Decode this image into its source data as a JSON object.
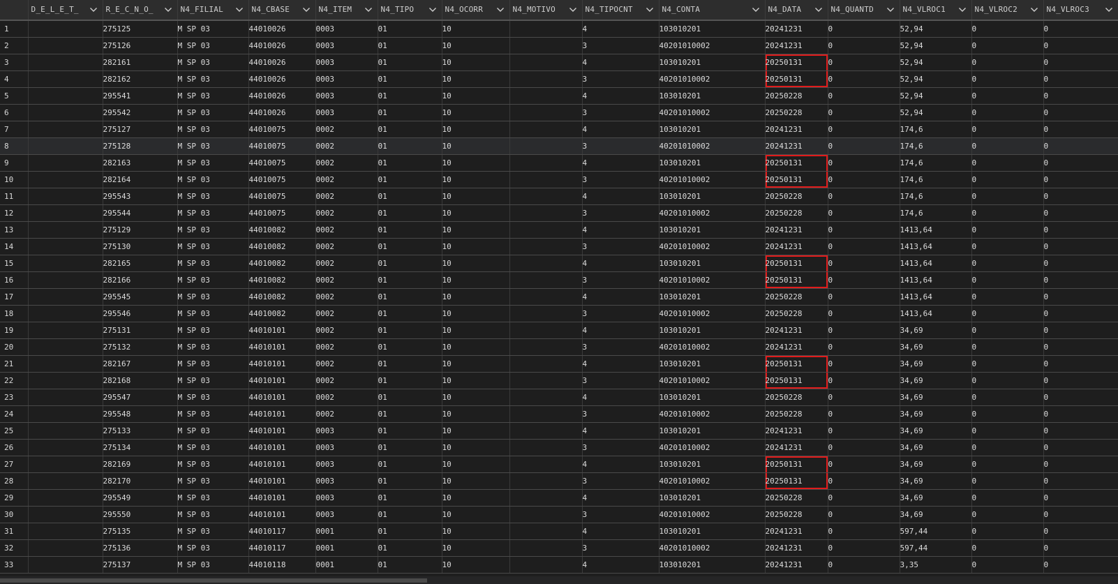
{
  "columns": [
    {
      "label": "",
      "filter": false
    },
    {
      "label": "D_E_L_E_T_",
      "filter": true
    },
    {
      "label": "R_E_C_N_O_",
      "filter": true
    },
    {
      "label": "N4_FILIAL",
      "filter": true
    },
    {
      "label": "N4_CBASE",
      "filter": true
    },
    {
      "label": "N4_ITEM",
      "filter": true
    },
    {
      "label": "N4_TIPO",
      "filter": true
    },
    {
      "label": "N4_OCORR",
      "filter": true
    },
    {
      "label": "N4_MOTIVO",
      "filter": true
    },
    {
      "label": "N4_TIPOCNT",
      "filter": true
    },
    {
      "label": "N4_CONTA",
      "filter": true
    },
    {
      "label": "N4_DATA",
      "filter": true
    },
    {
      "label": "N4_QUANTD",
      "filter": true
    },
    {
      "label": "N4_VLROC1",
      "filter": true
    },
    {
      "label": "N4_VLROC2",
      "filter": true
    },
    {
      "label": "N4_VLROC3",
      "filter": true
    }
  ],
  "highlight_color": "#e01b1b",
  "rows": [
    {
      "n": "1",
      "deleted": "",
      "recno": "275125",
      "filial": "M SP 03",
      "cbase": "44010026",
      "item": "0003",
      "tipo": "01",
      "ocorr": "10",
      "motivo": "",
      "tipocnt": "4",
      "conta": "103010201",
      "data": "20241231",
      "quantd": "0",
      "vlroc1": "52,94",
      "vlroc2": "0",
      "vlroc3": "0",
      "hl": ""
    },
    {
      "n": "2",
      "deleted": "",
      "recno": "275126",
      "filial": "M SP 03",
      "cbase": "44010026",
      "item": "0003",
      "tipo": "01",
      "ocorr": "10",
      "motivo": "",
      "tipocnt": "3",
      "conta": "40201010002",
      "data": "20241231",
      "quantd": "0",
      "vlroc1": "52,94",
      "vlroc2": "0",
      "vlroc3": "0",
      "hl": ""
    },
    {
      "n": "3",
      "deleted": "",
      "recno": "282161",
      "filial": "M SP 03",
      "cbase": "44010026",
      "item": "0003",
      "tipo": "01",
      "ocorr": "10",
      "motivo": "",
      "tipocnt": "4",
      "conta": "103010201",
      "data": "20250131",
      "quantd": "0",
      "vlroc1": "52,94",
      "vlroc2": "0",
      "vlroc3": "0",
      "hl": "top"
    },
    {
      "n": "4",
      "deleted": "",
      "recno": "282162",
      "filial": "M SP 03",
      "cbase": "44010026",
      "item": "0003",
      "tipo": "01",
      "ocorr": "10",
      "motivo": "",
      "tipocnt": "3",
      "conta": "40201010002",
      "data": "20250131",
      "quantd": "0",
      "vlroc1": "52,94",
      "vlroc2": "0",
      "vlroc3": "0",
      "hl": "bot"
    },
    {
      "n": "5",
      "deleted": "",
      "recno": "295541",
      "filial": "M SP 03",
      "cbase": "44010026",
      "item": "0003",
      "tipo": "01",
      "ocorr": "10",
      "motivo": "",
      "tipocnt": "4",
      "conta": "103010201",
      "data": "20250228",
      "quantd": "0",
      "vlroc1": "52,94",
      "vlroc2": "0",
      "vlroc3": "0",
      "hl": ""
    },
    {
      "n": "6",
      "deleted": "",
      "recno": "295542",
      "filial": "M SP 03",
      "cbase": "44010026",
      "item": "0003",
      "tipo": "01",
      "ocorr": "10",
      "motivo": "",
      "tipocnt": "3",
      "conta": "40201010002",
      "data": "20250228",
      "quantd": "0",
      "vlroc1": "52,94",
      "vlroc2": "0",
      "vlroc3": "0",
      "hl": ""
    },
    {
      "n": "7",
      "deleted": "",
      "recno": "275127",
      "filial": "M SP 03",
      "cbase": "44010075",
      "item": "0002",
      "tipo": "01",
      "ocorr": "10",
      "motivo": "",
      "tipocnt": "4",
      "conta": "103010201",
      "data": "20241231",
      "quantd": "0",
      "vlroc1": "174,6",
      "vlroc2": "0",
      "vlroc3": "0",
      "hl": ""
    },
    {
      "n": "8",
      "deleted": "",
      "recno": "275128",
      "filial": "M SP 03",
      "cbase": "44010075",
      "item": "0002",
      "tipo": "01",
      "ocorr": "10",
      "motivo": "",
      "tipocnt": "3",
      "conta": "40201010002",
      "data": "20241231",
      "quantd": "0",
      "vlroc1": "174,6",
      "vlroc2": "0",
      "vlroc3": "0",
      "hl": "",
      "alt": true
    },
    {
      "n": "9",
      "deleted": "",
      "recno": "282163",
      "filial": "M SP 03",
      "cbase": "44010075",
      "item": "0002",
      "tipo": "01",
      "ocorr": "10",
      "motivo": "",
      "tipocnt": "4",
      "conta": "103010201",
      "data": "20250131",
      "quantd": "0",
      "vlroc1": "174,6",
      "vlroc2": "0",
      "vlroc3": "0",
      "hl": "top"
    },
    {
      "n": "10",
      "deleted": "",
      "recno": "282164",
      "filial": "M SP 03",
      "cbase": "44010075",
      "item": "0002",
      "tipo": "01",
      "ocorr": "10",
      "motivo": "",
      "tipocnt": "3",
      "conta": "40201010002",
      "data": "20250131",
      "quantd": "0",
      "vlroc1": "174,6",
      "vlroc2": "0",
      "vlroc3": "0",
      "hl": "bot"
    },
    {
      "n": "11",
      "deleted": "",
      "recno": "295543",
      "filial": "M SP 03",
      "cbase": "44010075",
      "item": "0002",
      "tipo": "01",
      "ocorr": "10",
      "motivo": "",
      "tipocnt": "4",
      "conta": "103010201",
      "data": "20250228",
      "quantd": "0",
      "vlroc1": "174,6",
      "vlroc2": "0",
      "vlroc3": "0",
      "hl": ""
    },
    {
      "n": "12",
      "deleted": "",
      "recno": "295544",
      "filial": "M SP 03",
      "cbase": "44010075",
      "item": "0002",
      "tipo": "01",
      "ocorr": "10",
      "motivo": "",
      "tipocnt": "3",
      "conta": "40201010002",
      "data": "20250228",
      "quantd": "0",
      "vlroc1": "174,6",
      "vlroc2": "0",
      "vlroc3": "0",
      "hl": ""
    },
    {
      "n": "13",
      "deleted": "",
      "recno": "275129",
      "filial": "M SP 03",
      "cbase": "44010082",
      "item": "0002",
      "tipo": "01",
      "ocorr": "10",
      "motivo": "",
      "tipocnt": "4",
      "conta": "103010201",
      "data": "20241231",
      "quantd": "0",
      "vlroc1": "1413,64",
      "vlroc2": "0",
      "vlroc3": "0",
      "hl": ""
    },
    {
      "n": "14",
      "deleted": "",
      "recno": "275130",
      "filial": "M SP 03",
      "cbase": "44010082",
      "item": "0002",
      "tipo": "01",
      "ocorr": "10",
      "motivo": "",
      "tipocnt": "3",
      "conta": "40201010002",
      "data": "20241231",
      "quantd": "0",
      "vlroc1": "1413,64",
      "vlroc2": "0",
      "vlroc3": "0",
      "hl": ""
    },
    {
      "n": "15",
      "deleted": "",
      "recno": "282165",
      "filial": "M SP 03",
      "cbase": "44010082",
      "item": "0002",
      "tipo": "01",
      "ocorr": "10",
      "motivo": "",
      "tipocnt": "4",
      "conta": "103010201",
      "data": "20250131",
      "quantd": "0",
      "vlroc1": "1413,64",
      "vlroc2": "0",
      "vlroc3": "0",
      "hl": "top"
    },
    {
      "n": "16",
      "deleted": "",
      "recno": "282166",
      "filial": "M SP 03",
      "cbase": "44010082",
      "item": "0002",
      "tipo": "01",
      "ocorr": "10",
      "motivo": "",
      "tipocnt": "3",
      "conta": "40201010002",
      "data": "20250131",
      "quantd": "0",
      "vlroc1": "1413,64",
      "vlroc2": "0",
      "vlroc3": "0",
      "hl": "bot"
    },
    {
      "n": "17",
      "deleted": "",
      "recno": "295545",
      "filial": "M SP 03",
      "cbase": "44010082",
      "item": "0002",
      "tipo": "01",
      "ocorr": "10",
      "motivo": "",
      "tipocnt": "4",
      "conta": "103010201",
      "data": "20250228",
      "quantd": "0",
      "vlroc1": "1413,64",
      "vlroc2": "0",
      "vlroc3": "0",
      "hl": ""
    },
    {
      "n": "18",
      "deleted": "",
      "recno": "295546",
      "filial": "M SP 03",
      "cbase": "44010082",
      "item": "0002",
      "tipo": "01",
      "ocorr": "10",
      "motivo": "",
      "tipocnt": "3",
      "conta": "40201010002",
      "data": "20250228",
      "quantd": "0",
      "vlroc1": "1413,64",
      "vlroc2": "0",
      "vlroc3": "0",
      "hl": ""
    },
    {
      "n": "19",
      "deleted": "",
      "recno": "275131",
      "filial": "M SP 03",
      "cbase": "44010101",
      "item": "0002",
      "tipo": "01",
      "ocorr": "10",
      "motivo": "",
      "tipocnt": "4",
      "conta": "103010201",
      "data": "20241231",
      "quantd": "0",
      "vlroc1": "34,69",
      "vlroc2": "0",
      "vlroc3": "0",
      "hl": ""
    },
    {
      "n": "20",
      "deleted": "",
      "recno": "275132",
      "filial": "M SP 03",
      "cbase": "44010101",
      "item": "0002",
      "tipo": "01",
      "ocorr": "10",
      "motivo": "",
      "tipocnt": "3",
      "conta": "40201010002",
      "data": "20241231",
      "quantd": "0",
      "vlroc1": "34,69",
      "vlroc2": "0",
      "vlroc3": "0",
      "hl": ""
    },
    {
      "n": "21",
      "deleted": "",
      "recno": "282167",
      "filial": "M SP 03",
      "cbase": "44010101",
      "item": "0002",
      "tipo": "01",
      "ocorr": "10",
      "motivo": "",
      "tipocnt": "4",
      "conta": "103010201",
      "data": "20250131",
      "quantd": "0",
      "vlroc1": "34,69",
      "vlroc2": "0",
      "vlroc3": "0",
      "hl": "top"
    },
    {
      "n": "22",
      "deleted": "",
      "recno": "282168",
      "filial": "M SP 03",
      "cbase": "44010101",
      "item": "0002",
      "tipo": "01",
      "ocorr": "10",
      "motivo": "",
      "tipocnt": "3",
      "conta": "40201010002",
      "data": "20250131",
      "quantd": "0",
      "vlroc1": "34,69",
      "vlroc2": "0",
      "vlroc3": "0",
      "hl": "bot"
    },
    {
      "n": "23",
      "deleted": "",
      "recno": "295547",
      "filial": "M SP 03",
      "cbase": "44010101",
      "item": "0002",
      "tipo": "01",
      "ocorr": "10",
      "motivo": "",
      "tipocnt": "4",
      "conta": "103010201",
      "data": "20250228",
      "quantd": "0",
      "vlroc1": "34,69",
      "vlroc2": "0",
      "vlroc3": "0",
      "hl": ""
    },
    {
      "n": "24",
      "deleted": "",
      "recno": "295548",
      "filial": "M SP 03",
      "cbase": "44010101",
      "item": "0002",
      "tipo": "01",
      "ocorr": "10",
      "motivo": "",
      "tipocnt": "3",
      "conta": "40201010002",
      "data": "20250228",
      "quantd": "0",
      "vlroc1": "34,69",
      "vlroc2": "0",
      "vlroc3": "0",
      "hl": ""
    },
    {
      "n": "25",
      "deleted": "",
      "recno": "275133",
      "filial": "M SP 03",
      "cbase": "44010101",
      "item": "0003",
      "tipo": "01",
      "ocorr": "10",
      "motivo": "",
      "tipocnt": "4",
      "conta": "103010201",
      "data": "20241231",
      "quantd": "0",
      "vlroc1": "34,69",
      "vlroc2": "0",
      "vlroc3": "0",
      "hl": ""
    },
    {
      "n": "26",
      "deleted": "",
      "recno": "275134",
      "filial": "M SP 03",
      "cbase": "44010101",
      "item": "0003",
      "tipo": "01",
      "ocorr": "10",
      "motivo": "",
      "tipocnt": "3",
      "conta": "40201010002",
      "data": "20241231",
      "quantd": "0",
      "vlroc1": "34,69",
      "vlroc2": "0",
      "vlroc3": "0",
      "hl": ""
    },
    {
      "n": "27",
      "deleted": "",
      "recno": "282169",
      "filial": "M SP 03",
      "cbase": "44010101",
      "item": "0003",
      "tipo": "01",
      "ocorr": "10",
      "motivo": "",
      "tipocnt": "4",
      "conta": "103010201",
      "data": "20250131",
      "quantd": "0",
      "vlroc1": "34,69",
      "vlroc2": "0",
      "vlroc3": "0",
      "hl": "top"
    },
    {
      "n": "28",
      "deleted": "",
      "recno": "282170",
      "filial": "M SP 03",
      "cbase": "44010101",
      "item": "0003",
      "tipo": "01",
      "ocorr": "10",
      "motivo": "",
      "tipocnt": "3",
      "conta": "40201010002",
      "data": "20250131",
      "quantd": "0",
      "vlroc1": "34,69",
      "vlroc2": "0",
      "vlroc3": "0",
      "hl": "bot"
    },
    {
      "n": "29",
      "deleted": "",
      "recno": "295549",
      "filial": "M SP 03",
      "cbase": "44010101",
      "item": "0003",
      "tipo": "01",
      "ocorr": "10",
      "motivo": "",
      "tipocnt": "4",
      "conta": "103010201",
      "data": "20250228",
      "quantd": "0",
      "vlroc1": "34,69",
      "vlroc2": "0",
      "vlroc3": "0",
      "hl": ""
    },
    {
      "n": "30",
      "deleted": "",
      "recno": "295550",
      "filial": "M SP 03",
      "cbase": "44010101",
      "item": "0003",
      "tipo": "01",
      "ocorr": "10",
      "motivo": "",
      "tipocnt": "3",
      "conta": "40201010002",
      "data": "20250228",
      "quantd": "0",
      "vlroc1": "34,69",
      "vlroc2": "0",
      "vlroc3": "0",
      "hl": ""
    },
    {
      "n": "31",
      "deleted": "",
      "recno": "275135",
      "filial": "M SP 03",
      "cbase": "44010117",
      "item": "0001",
      "tipo": "01",
      "ocorr": "10",
      "motivo": "",
      "tipocnt": "4",
      "conta": "103010201",
      "data": "20241231",
      "quantd": "0",
      "vlroc1": "597,44",
      "vlroc2": "0",
      "vlroc3": "0",
      "hl": ""
    },
    {
      "n": "32",
      "deleted": "",
      "recno": "275136",
      "filial": "M SP 03",
      "cbase": "44010117",
      "item": "0001",
      "tipo": "01",
      "ocorr": "10",
      "motivo": "",
      "tipocnt": "3",
      "conta": "40201010002",
      "data": "20241231",
      "quantd": "0",
      "vlroc1": "597,44",
      "vlroc2": "0",
      "vlroc3": "0",
      "hl": ""
    },
    {
      "n": "33",
      "deleted": "",
      "recno": "275137",
      "filial": "M SP 03",
      "cbase": "44010118",
      "item": "0001",
      "tipo": "01",
      "ocorr": "10",
      "motivo": "",
      "tipocnt": "4",
      "conta": "103010201",
      "data": "20241231",
      "quantd": "0",
      "vlroc1": "3,35",
      "vlroc2": "0",
      "vlroc3": "0",
      "hl": ""
    }
  ]
}
